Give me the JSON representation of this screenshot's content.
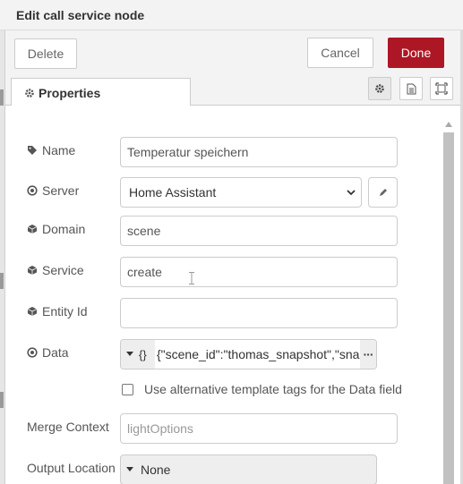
{
  "dialog": {
    "title": "Edit call service node"
  },
  "toolbar": {
    "delete_label": "Delete",
    "cancel_label": "Cancel",
    "done_label": "Done"
  },
  "tabs": {
    "properties_label": "Properties",
    "active_icon": "gear-icon"
  },
  "form": {
    "name": {
      "label": "Name",
      "value": "Temperatur speichern"
    },
    "server": {
      "label": "Server",
      "value": "Home Assistant"
    },
    "domain": {
      "label": "Domain",
      "value": "scene"
    },
    "service": {
      "label": "Service",
      "value": "create"
    },
    "entity_id": {
      "label": "Entity Id",
      "value": ""
    },
    "data": {
      "label": "Data",
      "type_symbol": "{}",
      "value": "{\"scene_id\":\"thomas_snapshot\",\"snapshot_entities\""
    },
    "alt_template": {
      "label": "Use alternative template tags for the Data field",
      "checked": false
    },
    "merge_context": {
      "label": "Merge Context",
      "placeholder": "lightOptions"
    },
    "output_location": {
      "label": "Output Location",
      "value": "None"
    }
  },
  "colors": {
    "done_button": "#ad1625",
    "panel_bg": "#f3f3f3"
  }
}
